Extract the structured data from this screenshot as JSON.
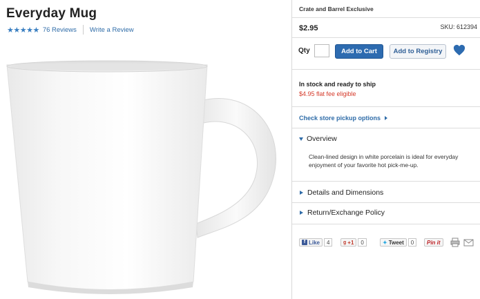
{
  "product": {
    "title": "Everyday Mug",
    "stars": "★★★★★",
    "reviews_label": "76 Reviews",
    "write_review_label": "Write a Review"
  },
  "purchase": {
    "brand": "Crate and Barrel Exclusive",
    "price": "$2.95",
    "sku": "SKU: 612394",
    "qty_label": "Qty",
    "qty_value": "",
    "add_to_cart": "Add to Cart",
    "add_to_registry": "Add to Registry",
    "stock_status": "In stock and ready to ship",
    "shipping_fee": "$4.95 flat fee eligible",
    "pickup_link": "Check store pickup options"
  },
  "details": {
    "overview_label": "Overview",
    "overview_text": "Clean-lined design in white porcelain is ideal for everyday enjoyment of your favorite hot pick-me-up.",
    "dimensions_label": "Details and Dimensions",
    "return_label": "Return/Exchange Policy"
  },
  "social": {
    "like_label": "Like",
    "like_count": "4",
    "plusone_label": "+1",
    "plusone_count": "0",
    "tweet_label": "Tweet",
    "tweet_count": "0",
    "pin_label": "Pin it"
  },
  "colors": {
    "accent": "#2d6bb0",
    "link": "#2f6ca8",
    "alert": "#d53a2a"
  }
}
